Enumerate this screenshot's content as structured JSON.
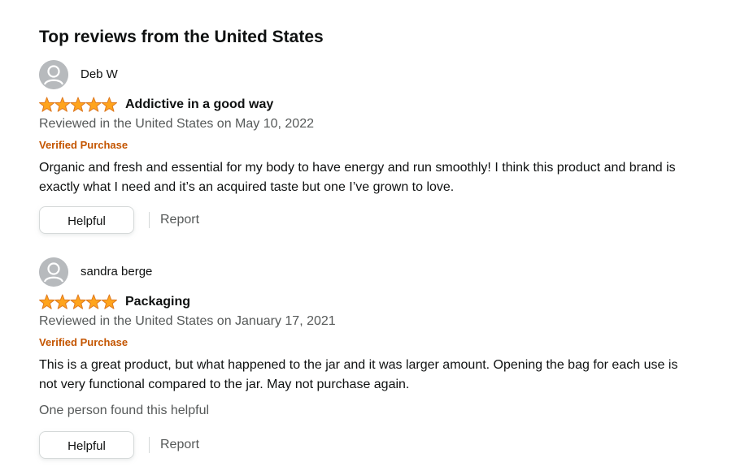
{
  "section": {
    "title": "Top reviews from the United States"
  },
  "colors": {
    "star": "#ffa41c",
    "star_outline": "#de7921",
    "verified": "#c45500",
    "muted_text": "#565959",
    "avatar_bg": "#b7babd"
  },
  "reviews": [
    {
      "profile_name": "Deb W",
      "avatar_icon": "default-avatar-icon",
      "rating": 5,
      "rating_max": 5,
      "title": "Addictive in a good way",
      "date": "Reviewed in the United States on May 10, 2022",
      "verified": "Verified Purchase",
      "body": "Organic and fresh and essential for my body to have energy and run smoothly! I think this product and brand is exactly what I need and it’s an acquired taste but one I’ve grown to love.",
      "helpful_count_text": "",
      "helpful_label": "Helpful",
      "report_label": "Report"
    },
    {
      "profile_name": "sandra berge",
      "avatar_icon": "default-avatar-icon",
      "rating": 5,
      "rating_max": 5,
      "title": "Packaging",
      "date": "Reviewed in the United States on January 17, 2021",
      "verified": "Verified Purchase",
      "body": "This is a great product, but what happened to the jar and it was larger amount. Opening the bag for each use is not very functional compared to the jar. May not purchase again.",
      "helpful_count_text": "One person found this helpful",
      "helpful_label": "Helpful",
      "report_label": "Report"
    }
  ]
}
